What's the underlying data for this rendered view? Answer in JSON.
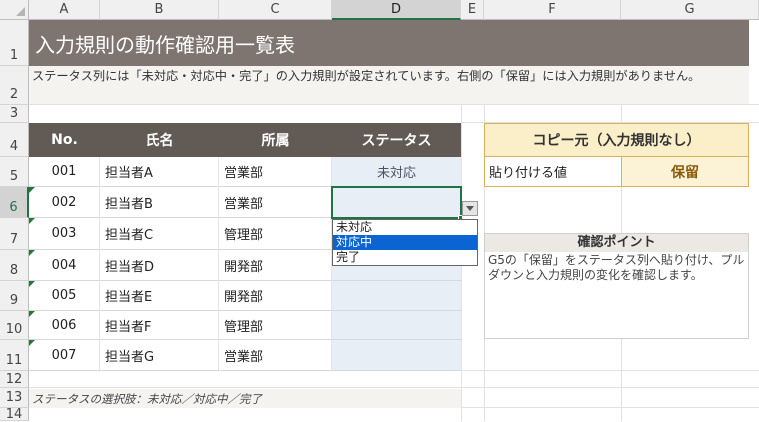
{
  "sheet": {
    "columns": [
      "A",
      "B",
      "C",
      "D",
      "E",
      "F",
      "G"
    ],
    "rows": [
      "1",
      "2",
      "3",
      "4",
      "5",
      "6",
      "7",
      "8",
      "9",
      "10",
      "11",
      "12",
      "13",
      "14"
    ],
    "title": "入力規則の動作確認用一覧表",
    "description": "ステータス列には「未対応・対応中・完了」の入力規則が設定されています。右側の「保留」には入力規則がありません。",
    "table": {
      "headers": [
        "No.",
        "氏名",
        "所属",
        "ステータス"
      ],
      "rows": [
        {
          "no": "001",
          "name": "担当者A",
          "dept": "営業部",
          "status": "未対応"
        },
        {
          "no": "002",
          "name": "担当者B",
          "dept": "営業部",
          "status": ""
        },
        {
          "no": "003",
          "name": "担当者C",
          "dept": "管理部",
          "status": ""
        },
        {
          "no": "004",
          "name": "担当者D",
          "dept": "開発部",
          "status": ""
        },
        {
          "no": "005",
          "name": "担当者E",
          "dept": "開発部",
          "status": ""
        },
        {
          "no": "006",
          "name": "担当者F",
          "dept": "管理部",
          "status": ""
        },
        {
          "no": "007",
          "name": "担当者G",
          "dept": "営業部",
          "status": ""
        }
      ]
    },
    "dropdown": {
      "options": [
        "未対応",
        "対応中",
        "完了"
      ],
      "highlighted": "対応中"
    },
    "copy_box": {
      "title": "コピー元（入力規則なし）",
      "label": "貼り付ける値",
      "value": "保留"
    },
    "check_box": {
      "title": "確認ポイント",
      "text": "G5の「保留」をステータス列へ貼り付け、プルダウンと入力規則の変化を確認します。"
    },
    "footnote": "ステータスの選択肢：未対応／対応中／完了"
  },
  "colors": {
    "title_bg": "#7f7570",
    "header_bg": "#625a55",
    "status_fill": "#e7eef6",
    "accent_green": "#217346",
    "copy_title_bg": "#fbefc9",
    "copy_border": "#d7b25b",
    "check_title_bg": "#ece9e4",
    "dropdown_highlight": "#0a64d2"
  }
}
